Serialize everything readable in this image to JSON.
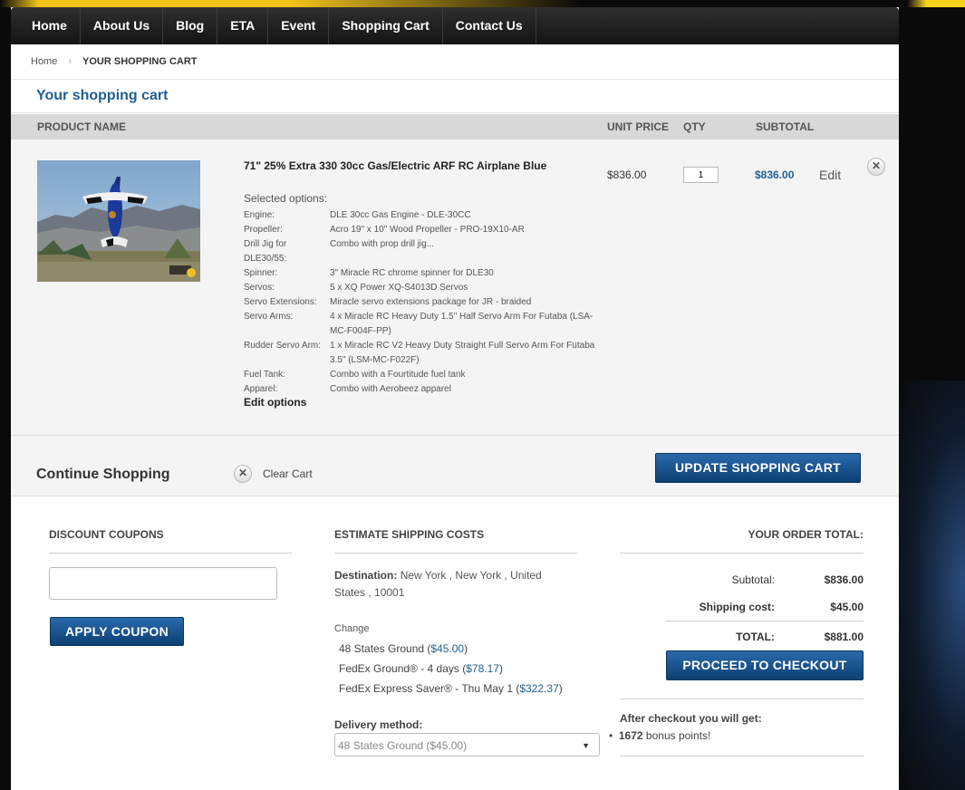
{
  "nav": [
    "Home",
    "About Us",
    "Blog",
    "ETA",
    "Event",
    "Shopping Cart",
    "Contact Us"
  ],
  "breadcrumb": {
    "home": "Home",
    "separator": "›",
    "current": "YOUR SHOPPING CART"
  },
  "page_title": "Your shopping cart",
  "table_headers": {
    "product": "PRODUCT NAME",
    "unit_price": "UNIT PRICE",
    "qty": "QTY",
    "subtotal": "SUBTOTAL"
  },
  "item": {
    "name": "71\" 25% Extra 330 30cc Gas/Electric ARF RC Airplane Blue",
    "selected_options_label": "Selected options:",
    "options": [
      {
        "k": "Engine:",
        "v": "DLE 30cc Gas Engine - DLE-30CC"
      },
      {
        "k": "Propeller:",
        "v": "Acro 19\" x 10\" Wood Propeller - PRO-19X10-AR"
      },
      {
        "k": "Drill Jig for DLE30/55:",
        "v": "Combo with prop drill jig..."
      },
      {
        "k": "Spinner:",
        "v": "3\" Miracle RC chrome spinner for DLE30"
      },
      {
        "k": "Servos:",
        "v": "5 x XQ Power XQ-S4013D Servos"
      },
      {
        "k": "Servo Extensions:",
        "v": "Miracle servo extensions package for JR - braided"
      },
      {
        "k": "Servo Arms:",
        "v": "4 x Miracle RC Heavy Duty 1.5\" Half Servo Arm For Futaba (LSA-MC-F004F-PP)"
      },
      {
        "k": "Rudder Servo Arm:",
        "v": "1 x Miracle RC V2 Heavy Duty Straight Full Servo Arm For Futaba 3.5\" (LSM-MC-F022F)"
      },
      {
        "k": "Fuel Tank:",
        "v": "Combo with a Fourtitude fuel tank"
      },
      {
        "k": "Apparel:",
        "v": "Combo with Aerobeez apparel"
      }
    ],
    "edit_options": "Edit options",
    "unit_price": "$836.00",
    "qty": "1",
    "subtotal": "$836.00",
    "edit": "Edit",
    "remove_icon": "✕"
  },
  "actions": {
    "continue": "Continue Shopping",
    "clear": "Clear Cart",
    "update": "UPDATE SHOPPING CART"
  },
  "discount": {
    "title": "DISCOUNT COUPONS",
    "apply": "APPLY COUPON"
  },
  "shipping": {
    "title": "ESTIMATE SHIPPING COSTS",
    "destination_label": "Destination:",
    "destination": "New York , New York , United States , 10001",
    "change": "Change",
    "options": [
      {
        "label": "48 States Ground (",
        "price": "$45.00",
        "close": ")"
      },
      {
        "label": "FedEx Ground® - 4 days (",
        "price": "$78.17",
        "close": ")"
      },
      {
        "label": "FedEx Express Saver® - Thu May 1 (",
        "price": "$322.37",
        "close": ")"
      }
    ],
    "delivery_label": "Delivery method:",
    "delivery_selected": "48 States Ground ($45.00)"
  },
  "totals": {
    "title": "YOUR ORDER TOTAL:",
    "subtotal_label": "Subtotal:",
    "subtotal": "$836.00",
    "shipping_label": "Shipping cost:",
    "shipping": "$45.00",
    "total_label": "TOTAL:",
    "total": "$881.00",
    "checkout": "PROCEED TO CHECKOUT",
    "after_label": "After checkout you will get:",
    "bonus_points": "1672",
    "bonus_text": "bonus points!"
  },
  "colors": {
    "link_blue": "#1f5f93",
    "button_blue": "#1a5592",
    "nav_dark": "#1e1e1e",
    "accent_yellow": "#f3c21a"
  }
}
